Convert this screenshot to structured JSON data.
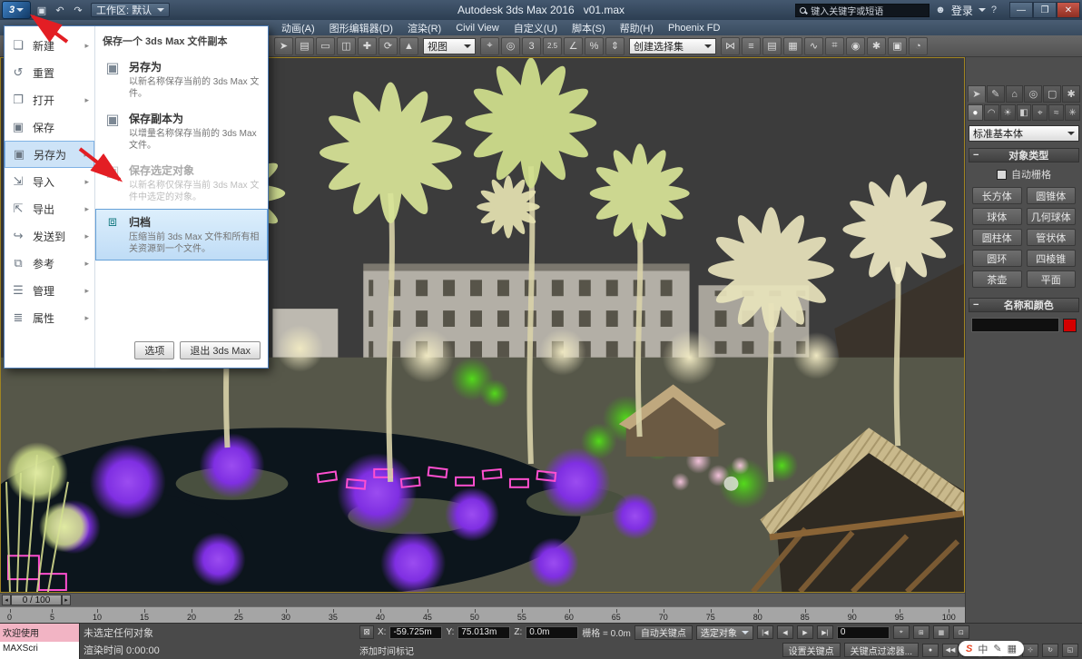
{
  "colors": {
    "selection_blue": "#bfdcf6",
    "annotation_red": "#e31e24",
    "object_color_swatch": "#d40000"
  },
  "titlebar": {
    "workspace": "工作区: 默认",
    "title": "Autodesk 3ds Max 2016",
    "filename": "v01.max",
    "search_placeholder": "键入关键字或短语",
    "signin": "登录",
    "help": "?",
    "win_min": "—",
    "win_max": "❐",
    "win_close": "✕",
    "qat": {
      "save": "▣",
      "undo": "↶",
      "redo": "↷"
    }
  },
  "menubar": {
    "items": [
      "动画(A)",
      "图形编辑器(D)",
      "渲染(R)",
      "Civil View",
      "自定义(U)",
      "脚本(S)",
      "帮助(H)",
      "Phoenix FD"
    ]
  },
  "toolbar": {
    "view_value": "视图",
    "selset_value": "创建选择集",
    "icons_a": [
      {
        "n": "select-object-icon",
        "g": "➤"
      },
      {
        "n": "select-by-name-icon",
        "g": "▤"
      },
      {
        "n": "rect-region-icon",
        "g": "▭"
      },
      {
        "n": "crossing-region-icon",
        "g": "◫"
      },
      {
        "n": "move-icon",
        "g": "✚"
      },
      {
        "n": "rotate-icon",
        "g": "⟳"
      },
      {
        "n": "scale-icon",
        "g": "▲"
      }
    ],
    "icons_b": [
      {
        "n": "ref-coord-icon",
        "g": "⌖"
      },
      {
        "n": "use-center-icon",
        "g": "◎"
      },
      {
        "n": "snap-3d-icon",
        "g": "3"
      },
      {
        "n": "snap-25d-icon",
        "g": "2.5"
      },
      {
        "n": "angle-snap-icon",
        "g": "∠"
      },
      {
        "n": "percent-snap-icon",
        "g": "%"
      },
      {
        "n": "spinner-snap-icon",
        "g": "⇕"
      }
    ],
    "icons_c": [
      {
        "n": "mirror-icon",
        "g": "⋈"
      },
      {
        "n": "align-icon",
        "g": "≡"
      },
      {
        "n": "layer-manager-icon",
        "g": "▤"
      },
      {
        "n": "ribbon-toggle-icon",
        "g": "▦"
      },
      {
        "n": "curve-editor-icon",
        "g": "∿"
      },
      {
        "n": "schematic-view-icon",
        "g": "⌗"
      },
      {
        "n": "material-editor-icon",
        "g": "◉"
      },
      {
        "n": "render-setup-icon",
        "g": "✱"
      },
      {
        "n": "rendered-frame-icon",
        "g": "▣"
      },
      {
        "n": "render-production-icon",
        "g": "◔"
      }
    ]
  },
  "app_menu": {
    "header": "保存一个 3ds Max 文件副本",
    "left_items": [
      {
        "icon": "❏",
        "label": "新建",
        "sub": "▸"
      },
      {
        "icon": "↺",
        "label": "重置",
        "sub": ""
      },
      {
        "icon": "❐",
        "label": "打开",
        "sub": "▸"
      },
      {
        "icon": "▣",
        "label": "保存",
        "sub": ""
      },
      {
        "icon": "▣",
        "label": "另存为",
        "sub": "▸"
      },
      {
        "icon": "⇲",
        "label": "导入",
        "sub": "▸"
      },
      {
        "icon": "⇱",
        "label": "导出",
        "sub": "▸"
      },
      {
        "icon": "↪",
        "label": "发送到",
        "sub": "▸"
      },
      {
        "icon": "⧉",
        "label": "参考",
        "sub": "▸"
      },
      {
        "icon": "☰",
        "label": "管理",
        "sub": "▸"
      },
      {
        "icon": "≣",
        "label": "属性",
        "sub": "▸"
      }
    ],
    "options": [
      {
        "icon": "▣",
        "title": "另存为",
        "desc": "以新名称保存当前的 3ds Max 文件。"
      },
      {
        "icon": "▣",
        "title": "保存副本为",
        "desc": "以增量名称保存当前的 3ds Max 文件。"
      },
      {
        "icon": "▣",
        "title": "保存选定对象",
        "desc": "以新名称仅保存当前 3ds Max 文件中选定的对象。"
      },
      {
        "icon": "⧈",
        "title": "归档",
        "desc": "压缩当前 3ds Max 文件和所有相关资源到一个文件。"
      }
    ],
    "options_button": "选项",
    "exit_button": "退出 3ds Max"
  },
  "command_panel": {
    "tabs": [
      {
        "n": "tab-create",
        "g": "➤"
      },
      {
        "n": "tab-modify",
        "g": "✎"
      },
      {
        "n": "tab-hierarchy",
        "g": "⌂"
      },
      {
        "n": "tab-motion",
        "g": "◎"
      },
      {
        "n": "tab-display",
        "g": "▢"
      },
      {
        "n": "tab-utilities",
        "g": "✱"
      }
    ],
    "categories": [
      {
        "n": "cat-geometry",
        "g": "●"
      },
      {
        "n": "cat-shapes",
        "g": "◠"
      },
      {
        "n": "cat-lights",
        "g": "☀"
      },
      {
        "n": "cat-cameras",
        "g": "◧"
      },
      {
        "n": "cat-helpers",
        "g": "⌖"
      },
      {
        "n": "cat-spacewarps",
        "g": "≈"
      },
      {
        "n": "cat-systems",
        "g": "✳"
      }
    ],
    "subtype": "标准基本体",
    "object_type": {
      "collapse": "−",
      "title": "对象类型",
      "autogrid": "自动栅格",
      "buttons": [
        "长方体",
        "圆锥体",
        "球体",
        "几何球体",
        "圆柱体",
        "管状体",
        "圆环",
        "四棱锥",
        "茶壶",
        "平面"
      ]
    },
    "name_color": {
      "collapse": "−",
      "title": "名称和颜色"
    }
  },
  "timeline": {
    "prev": "◂",
    "next": "▸",
    "handle": "0 / 100",
    "ticks": [
      "0",
      "5",
      "10",
      "15",
      "20",
      "25",
      "30",
      "35",
      "40",
      "45",
      "50",
      "55",
      "60",
      "65",
      "70",
      "75",
      "80",
      "85",
      "90",
      "95",
      "100"
    ]
  },
  "statusbar": {
    "listener_top": "欢迎使用",
    "listener_bottom": "MAXScri",
    "status": "未选定任何对象",
    "prompt": "渲染时间 0:00:00",
    "lock_glyph": "⊠",
    "x_label": "X:",
    "x_value": "-59.725m",
    "y_label": "Y:",
    "y_value": "75.013m",
    "z_label": "Z:",
    "z_value": "0.0m",
    "grid": "栅格 = 0.0m",
    "add_time_tag": "添加时间标记",
    "auto_key": "自动关键点",
    "set_key": "设置关键点",
    "selected_dd": "选定对象",
    "key_filters": "关键点过滤器...",
    "frame": "0",
    "pb1": [
      "|◀",
      "◀",
      "▶",
      "▶|"
    ],
    "pb2": [
      "●",
      "◀◀",
      "▶▶",
      "◔"
    ],
    "nav1": [
      "⌖",
      "⊞",
      "▦",
      "⊡"
    ],
    "nav2": [
      "⊕",
      "⊹",
      "↻",
      "◱"
    ]
  },
  "ime": {
    "brand": "S",
    "mode": "中",
    "pen": "✎",
    "board": "▦"
  }
}
